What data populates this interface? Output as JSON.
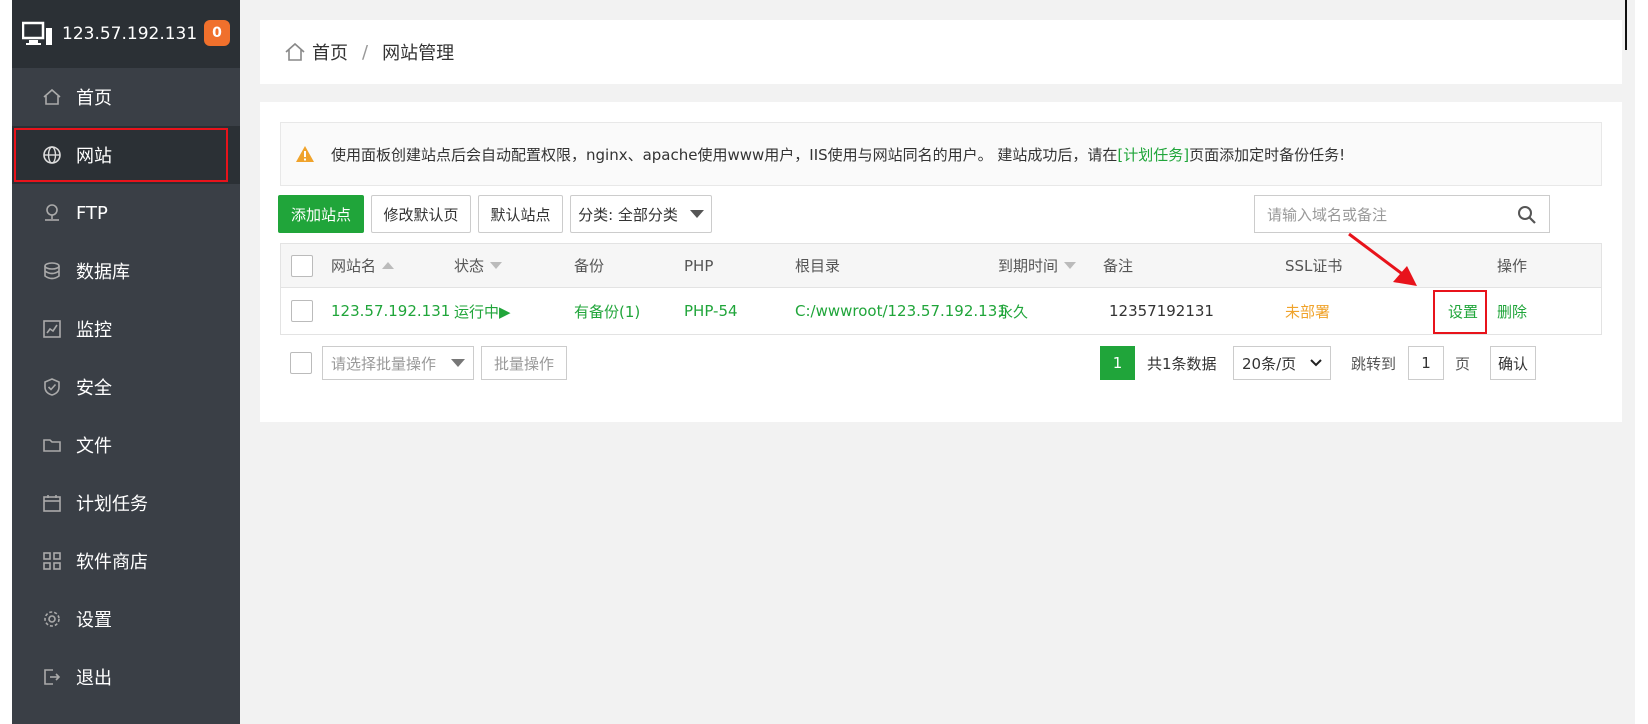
{
  "server": {
    "ip": "123.57.192.131",
    "badge": "0"
  },
  "sidebar": {
    "items": [
      {
        "label": "首页",
        "icon": "home-icon"
      },
      {
        "label": "网站",
        "icon": "globe-icon"
      },
      {
        "label": "FTP",
        "icon": "ftp-icon"
      },
      {
        "label": "数据库",
        "icon": "database-icon"
      },
      {
        "label": "监控",
        "icon": "monitor-icon"
      },
      {
        "label": "安全",
        "icon": "shield-icon"
      },
      {
        "label": "文件",
        "icon": "folder-icon"
      },
      {
        "label": "计划任务",
        "icon": "calendar-icon"
      },
      {
        "label": "软件商店",
        "icon": "apps-icon"
      },
      {
        "label": "设置",
        "icon": "gear-icon"
      },
      {
        "label": "退出",
        "icon": "logout-icon"
      }
    ]
  },
  "breadcrumb": {
    "home": "首页",
    "separator": "/",
    "current": "网站管理"
  },
  "notice": {
    "text_before": "使用面板创建站点后会自动配置权限，nginx、apache使用www用户，IIS使用与网站同名的用户。 建站成功后，请在",
    "link": "[计划任务]",
    "text_after": "页面添加定时备份任务!"
  },
  "toolbar": {
    "add_site": "添加站点",
    "modify_default_page": "修改默认页",
    "default_site": "默认站点",
    "category": "分类: 全部分类",
    "search_placeholder": "请输入域名或备注"
  },
  "table": {
    "headers": {
      "name": "网站名",
      "status": "状态",
      "backup": "备份",
      "php": "PHP",
      "root": "根目录",
      "expire": "到期时间",
      "remark": "备注",
      "ssl": "SSL证书",
      "action": "操作"
    },
    "rows": [
      {
        "name": "123.57.192.131",
        "status": "运行中▶",
        "backup": "有备份(1)",
        "php": "PHP-54",
        "root": "C:/wwwroot/123.57.192.131",
        "expire": "永久",
        "remark": "12357192131",
        "ssl": "未部署",
        "settings": "设置",
        "delete": "删除"
      }
    ]
  },
  "footer": {
    "batch_select_placeholder": "请选择批量操作",
    "batch_button": "批量操作",
    "current_page": "1",
    "total": "共1条数据",
    "per_page": "20条/页",
    "jump_label": "跳转到",
    "jump_value": "1",
    "page_unit": "页",
    "confirm": "确认"
  },
  "colors": {
    "accent": "#20a53a",
    "highlight": "#e8131b",
    "sidebar": "#3a3f46"
  }
}
